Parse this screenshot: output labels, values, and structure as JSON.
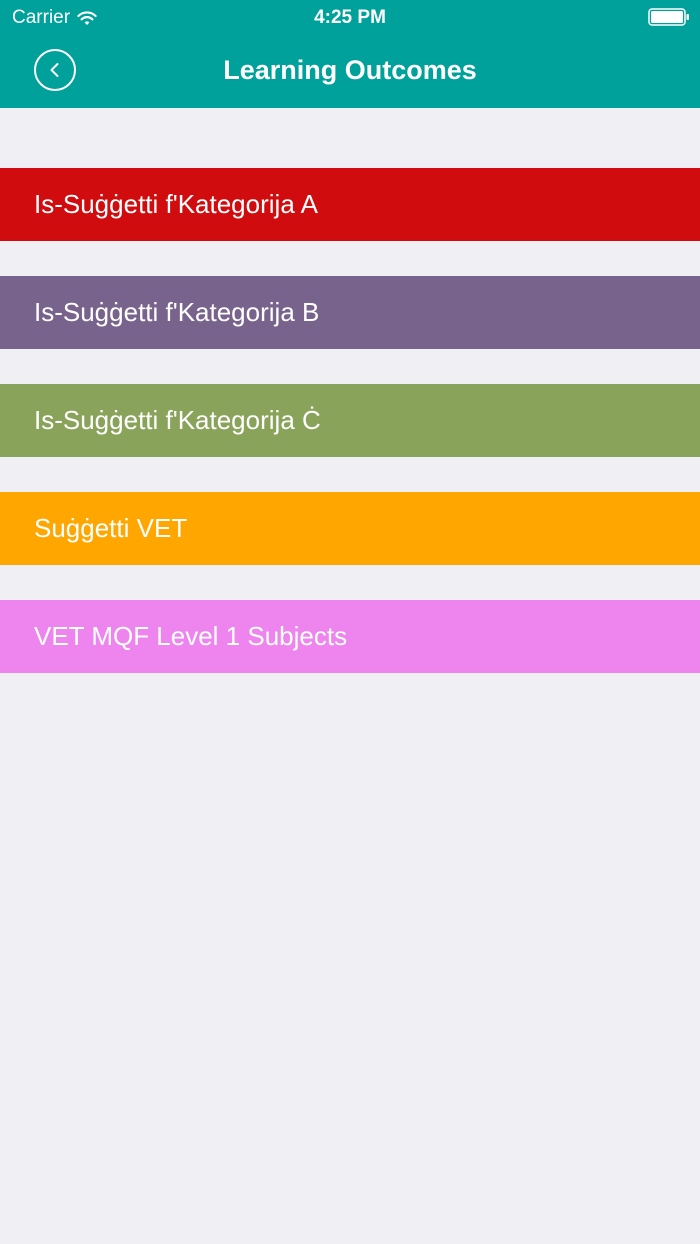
{
  "status_bar": {
    "carrier": "Carrier",
    "time": "4:25 PM"
  },
  "nav": {
    "title": "Learning Outcomes",
    "back_icon": "chevron-left-icon"
  },
  "colors": {
    "header": "#00a19a",
    "background": "#efeff4"
  },
  "categories": [
    {
      "label": "Is-Suġġetti f'Kategorija A",
      "color": "#d00c0e"
    },
    {
      "label": "Is-Suġġetti f'Kategorija B",
      "color": "#77638c"
    },
    {
      "label": "Is-Suġġetti f'Kategorija Ċ",
      "color": "#89a35a"
    },
    {
      "label": "Suġġetti VET",
      "color": "#ffa600"
    },
    {
      "label": "VET MQF Level 1 Subjects",
      "color": "#ee84ee"
    }
  ]
}
